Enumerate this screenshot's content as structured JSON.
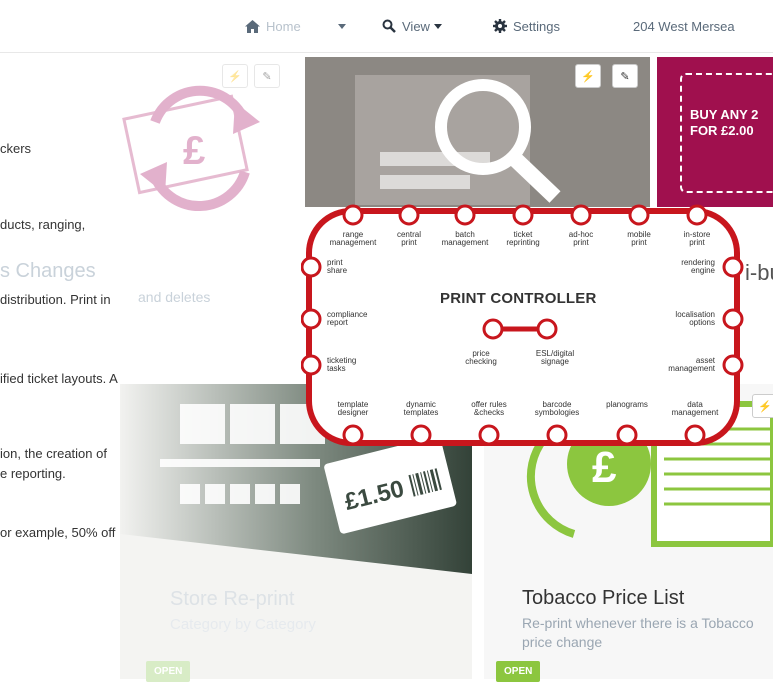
{
  "nav": {
    "home_label": "Home",
    "view_label": "View",
    "settings_label": "Settings",
    "store_label": "204 West Mersea"
  },
  "background": {
    "left_texts": [
      "ckers",
      "ducts, ranging,",
      "s  Changes",
      "and deletes",
      "distribution. Print in",
      "ified  ticket layouts. A",
      "ion, the creation of",
      "e  reporting.",
      "or example, 50% off"
    ],
    "promo_line1": "BUY ANY 2",
    "promo_line2": "FOR £2.00",
    "price_tag": "£1.50",
    "right_fragment": "i-bu",
    "store_reprint": {
      "title": "Store Re-print",
      "subtitle": "Category by Category",
      "open": "OPEN"
    },
    "tobacco": {
      "title": "Tobacco Price List",
      "subtitle_line1": "Re-print whenever there is a Tobacco",
      "subtitle_line2": "price change",
      "open": "OPEN"
    }
  },
  "controller": {
    "title": "PRINT CONTROLLER",
    "top": [
      [
        "range",
        "management"
      ],
      [
        "central",
        "print"
      ],
      [
        "batch",
        "management"
      ],
      [
        "ticket",
        "reprinting"
      ],
      [
        "ad-hoc",
        "print"
      ],
      [
        "mobile",
        "print"
      ],
      [
        "in-store",
        "print"
      ]
    ],
    "left": [
      [
        "print",
        "share"
      ],
      [
        "compliance",
        "report"
      ],
      [
        "ticketing",
        "tasks"
      ]
    ],
    "right": [
      [
        "rendering",
        "engine"
      ],
      [
        "localisation",
        "options"
      ],
      [
        "asset",
        "management"
      ]
    ],
    "bottom": [
      [
        "template",
        "designer"
      ],
      [
        "dynamic",
        "templates"
      ],
      [
        "offer rules",
        "&checks"
      ],
      [
        "barcode",
        "symbologies"
      ],
      [
        "planograms",
        ""
      ],
      [
        "data",
        "management"
      ]
    ],
    "center": [
      [
        "price",
        "checking"
      ],
      [
        "ESL/digital",
        "signage"
      ]
    ]
  },
  "colors": {
    "controller_red": "#c8161d",
    "accent_green": "#8cc63f",
    "promo_magenta": "#a0104e",
    "nav_text": "#5a6a7a"
  }
}
